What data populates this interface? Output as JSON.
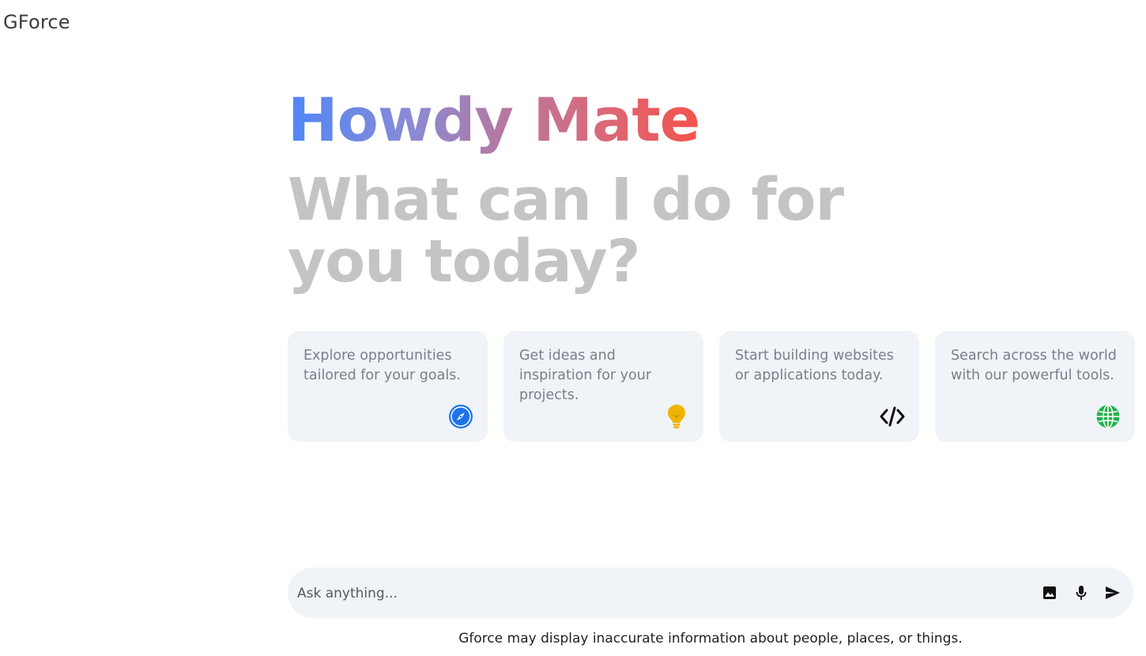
{
  "app": {
    "title": "GForce"
  },
  "hero": {
    "greeting": "Howdy Mate",
    "subheading": "What can I do for you today?"
  },
  "cards": [
    {
      "text": "Explore opportunities tailored for your goals.",
      "icon": "compass-icon",
      "color": "#1e73e8"
    },
    {
      "text": "Get ideas and inspiration for your projects.",
      "icon": "lightbulb-icon",
      "color": "#f0b400"
    },
    {
      "text": "Start building websites or applications today.",
      "icon": "code-icon",
      "color": "#111111"
    },
    {
      "text": "Search across the world with our powerful tools.",
      "icon": "globe-icon",
      "color": "#22b14c"
    }
  ],
  "prompt": {
    "placeholder": "Ask anything...",
    "actions": [
      "image-icon",
      "microphone-icon",
      "send-icon"
    ]
  },
  "footer": {
    "disclaimer": "Gforce may display inaccurate information about people, places, or things."
  },
  "colors": {
    "gradient_start": "#4f87f5",
    "gradient_end": "#f4524a",
    "subheading": "#c4c4c4",
    "surface": "#f0f3f8"
  }
}
